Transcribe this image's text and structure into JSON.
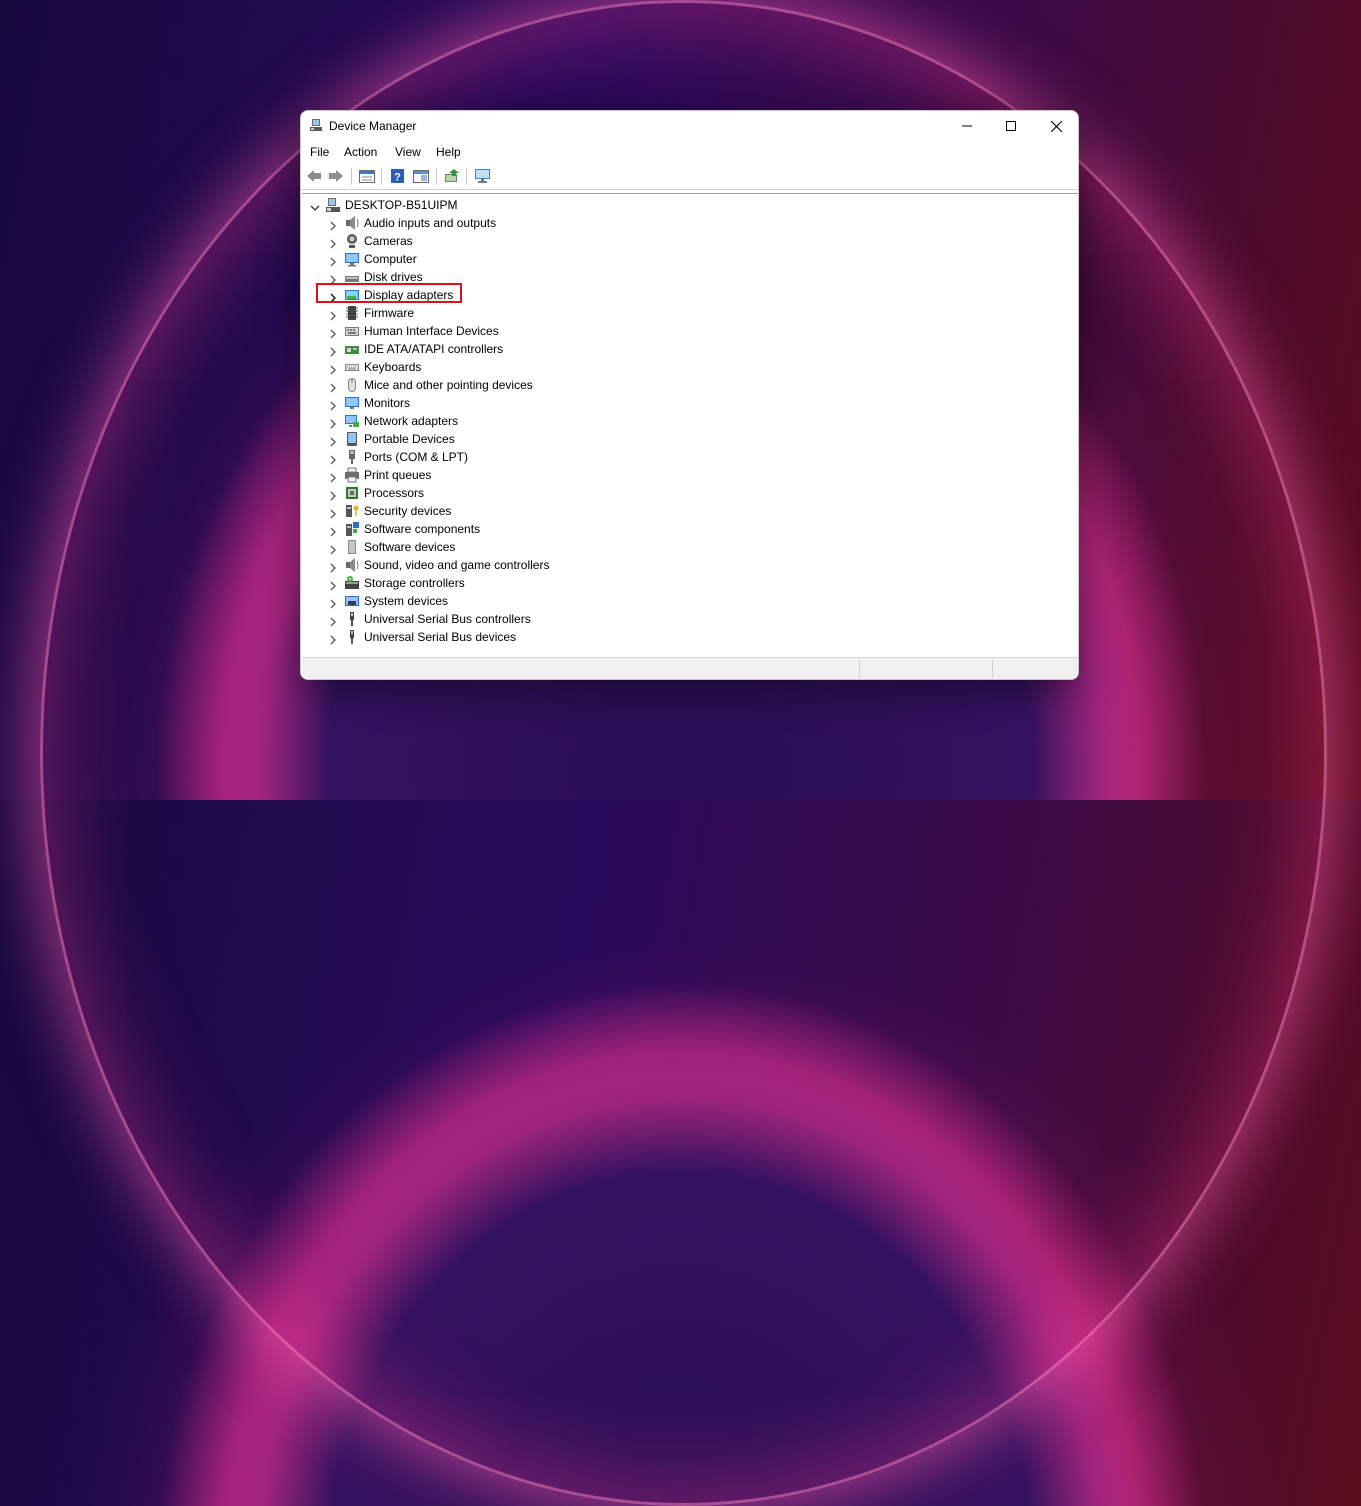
{
  "window": {
    "title": "Device Manager"
  },
  "menu": [
    "File",
    "Action",
    "View",
    "Help"
  ],
  "toolbar": [
    "back-arrow-icon",
    "forward-arrow-icon",
    "properties-icon",
    "help-icon",
    "view-icon",
    "update-driver-icon",
    "scan-hardware-icon"
  ],
  "tree": {
    "root": "DESKTOP-B51UIPM",
    "items": [
      {
        "label": "Audio inputs and outputs",
        "icon": "speaker-icon"
      },
      {
        "label": "Cameras",
        "icon": "camera-icon"
      },
      {
        "label": "Computer",
        "icon": "computer-icon"
      },
      {
        "label": "Disk drives",
        "icon": "disk-drive-icon"
      },
      {
        "label": "Display adapters",
        "icon": "display-adapter-icon",
        "highlighted": true
      },
      {
        "label": "Firmware",
        "icon": "firmware-icon"
      },
      {
        "label": "Human Interface Devices",
        "icon": "hid-icon"
      },
      {
        "label": "IDE ATA/ATAPI controllers",
        "icon": "ide-controller-icon"
      },
      {
        "label": "Keyboards",
        "icon": "keyboard-icon"
      },
      {
        "label": "Mice and other pointing devices",
        "icon": "mouse-icon"
      },
      {
        "label": "Monitors",
        "icon": "monitor-icon"
      },
      {
        "label": "Network adapters",
        "icon": "network-adapter-icon"
      },
      {
        "label": "Portable Devices",
        "icon": "portable-device-icon"
      },
      {
        "label": "Ports (COM & LPT)",
        "icon": "port-icon"
      },
      {
        "label": "Print queues",
        "icon": "printer-icon"
      },
      {
        "label": "Processors",
        "icon": "processor-icon"
      },
      {
        "label": "Security devices",
        "icon": "security-device-icon"
      },
      {
        "label": "Software components",
        "icon": "software-component-icon"
      },
      {
        "label": "Software devices",
        "icon": "software-device-icon"
      },
      {
        "label": "Sound, video and game controllers",
        "icon": "sound-controller-icon"
      },
      {
        "label": "Storage controllers",
        "icon": "storage-controller-icon"
      },
      {
        "label": "System devices",
        "icon": "system-device-icon"
      },
      {
        "label": "Universal Serial Bus controllers",
        "icon": "usb-controller-icon"
      },
      {
        "label": "Universal Serial Bus devices",
        "icon": "usb-device-icon"
      }
    ]
  },
  "colors": {
    "highlight": "#e0101a",
    "desktop_bg": "#2a0a5c"
  }
}
